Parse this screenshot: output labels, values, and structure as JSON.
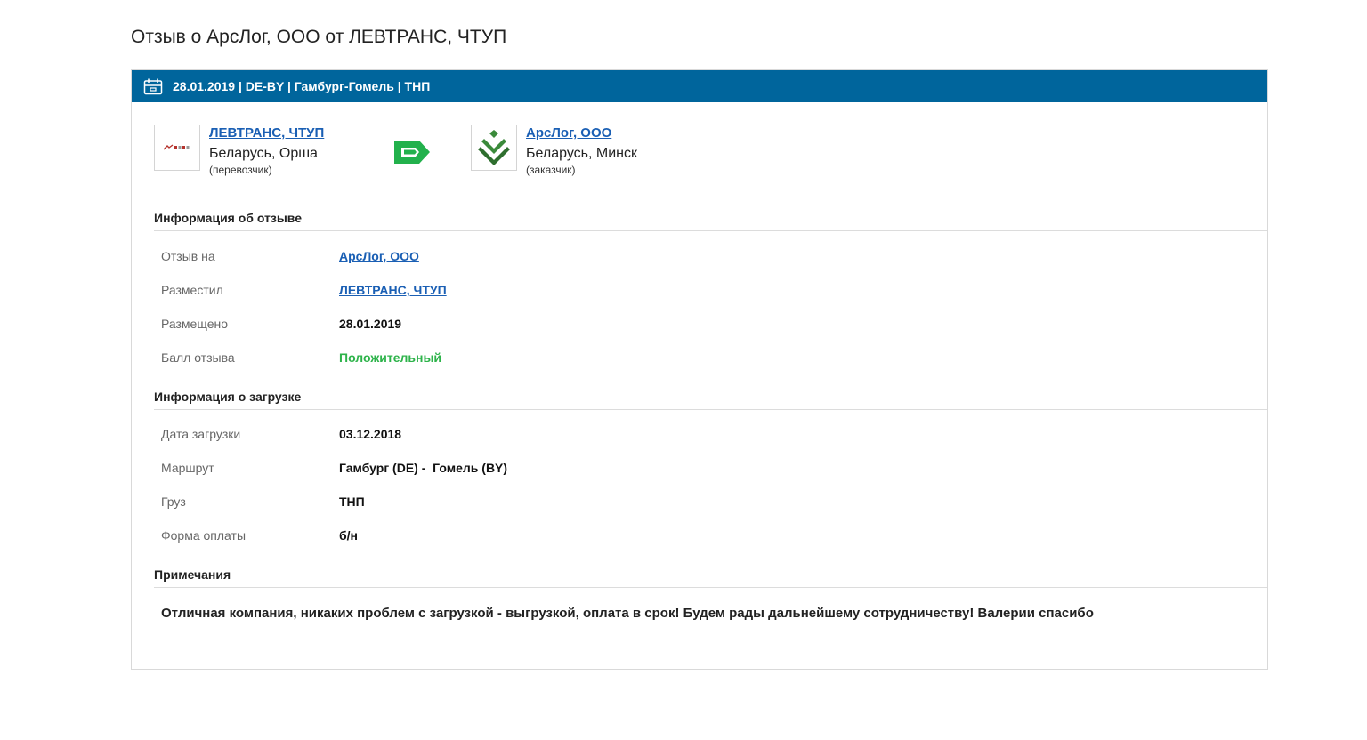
{
  "page": {
    "title": "Отзыв о АрсЛог, ООО от ЛЕВТРАНС, ЧТУП"
  },
  "header": {
    "summary": "28.01.2019 | DE-BY | Гамбург-Гомель | ТНП",
    "icon": "calendar-icon"
  },
  "carrier": {
    "name": "ЛЕВТРАНС, ЧТУП",
    "location": "Беларусь, Орша",
    "role": "(перевозчик)"
  },
  "customer": {
    "name": "АрсЛог, ООО",
    "location": "Беларусь, Минск",
    "role": "(заказчик)"
  },
  "review_info": {
    "title": "Информация об отзыве",
    "rows": [
      {
        "label": "Отзыв на",
        "value": "АрсЛог, ООО"
      },
      {
        "label": "Разместил",
        "value": "ЛЕВТРАНС, ЧТУП"
      },
      {
        "label": "Размещено",
        "value": "28.01.2019"
      },
      {
        "label": "Балл отзыва",
        "value": "Положительный"
      }
    ]
  },
  "load_info": {
    "title": "Информация о загрузке",
    "rows": [
      {
        "label": "Дата загрузки",
        "value": "03.12.2018"
      },
      {
        "label": "Маршрут",
        "value": "Гамбург (DE) -  Гомель (BY)"
      },
      {
        "label": "Груз",
        "value": "ТНП"
      },
      {
        "label": "Форма оплаты",
        "value": "б/н"
      }
    ]
  },
  "notes": {
    "title": "Примечания",
    "text": "Отличная компания, никаких проблем с загрузкой - выгрузкой, оплата в срок! Будем рады дальнейшему сотрудничеству! Валерии спасибо"
  },
  "colors": {
    "header_bg": "#00659c",
    "link": "#1a5fb4",
    "positive": "#2db34a",
    "arrow": "#22b14c",
    "logo_green": "#3a8a3a"
  }
}
